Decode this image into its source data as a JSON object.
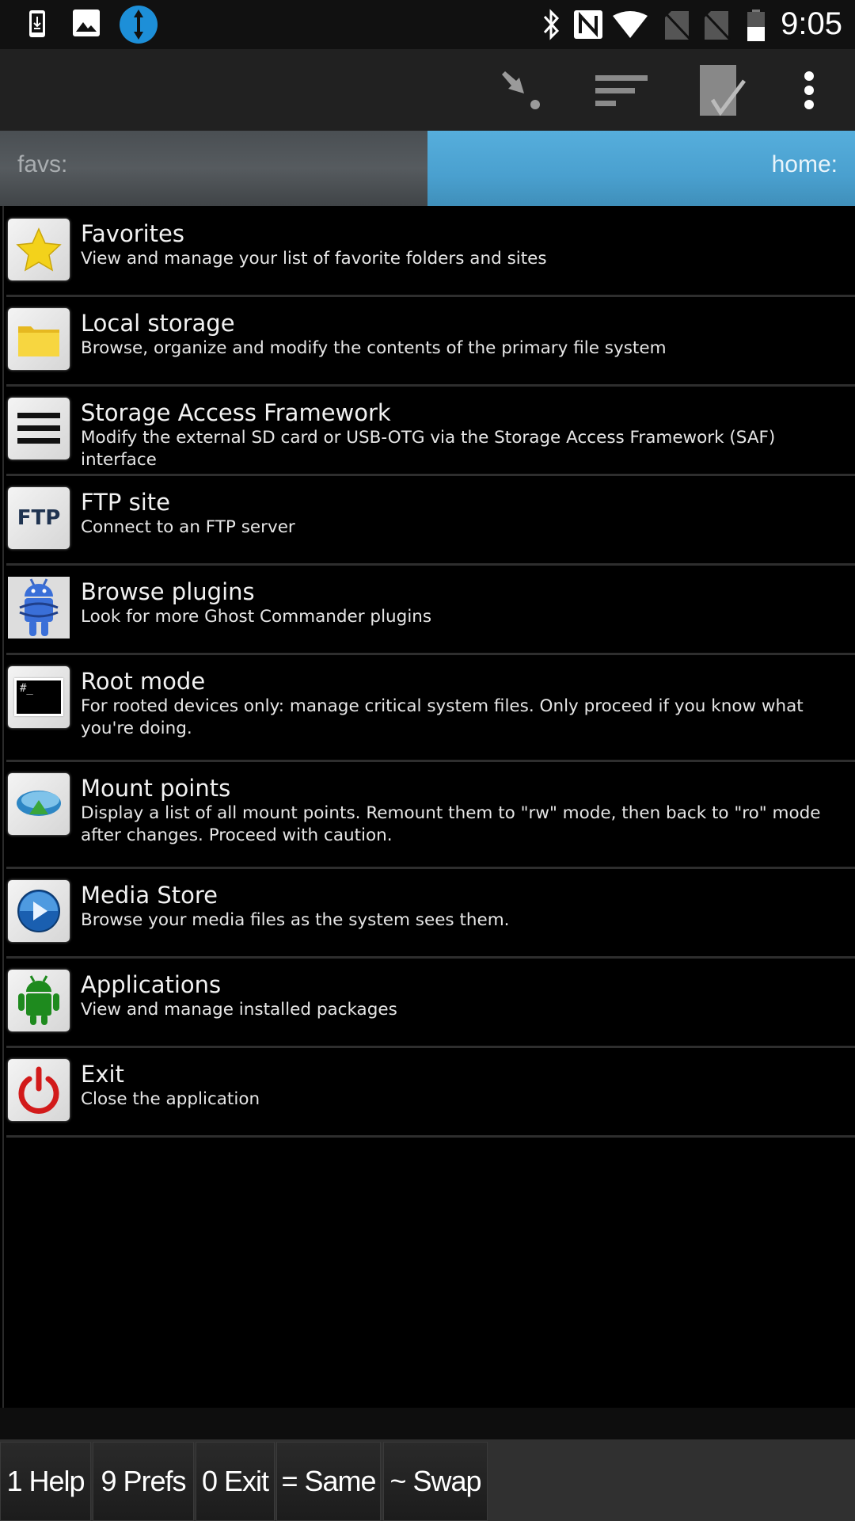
{
  "status_bar": {
    "time": "9:05",
    "left_icons": [
      "download-notification-icon",
      "image-notification-icon",
      "teamviewer-icon"
    ],
    "right_icons": [
      "bluetooth-icon",
      "nfc-icon",
      "wifi-icon",
      "no-sim-icon",
      "no-sim-icon",
      "battery-icon"
    ]
  },
  "toolbar": {
    "actions": [
      "go-to-icon",
      "sort-icon",
      "select-icon",
      "overflow-menu-icon"
    ]
  },
  "tabs": {
    "left": "favs:",
    "right": "home:",
    "active": "right",
    "active_color": "#4ba6d6"
  },
  "list": [
    {
      "title": "Favorites",
      "desc": "View and manage your list of favorite folders and sites",
      "icon": "star-icon"
    },
    {
      "title": "Local storage",
      "desc": "Browse, organize and modify the contents of the primary file system",
      "icon": "folder-icon"
    },
    {
      "title": "Storage Access Framework",
      "desc": "Modify the external SD card or USB-OTG via the Storage Access Framework (SAF) interface",
      "icon": "menu-lines-icon"
    },
    {
      "title": "FTP site",
      "desc": "Connect to an FTP server",
      "icon": "ftp-icon",
      "icon_text": "FTP"
    },
    {
      "title": "Browse plugins",
      "desc": "Look for more Ghost Commander plugins",
      "icon": "android-plugin-icon"
    },
    {
      "title": "Root mode",
      "desc": "For rooted devices only: manage critical system files. Only proceed if you know what you're doing.",
      "icon": "terminal-icon",
      "icon_text": "#_"
    },
    {
      "title": "Mount points",
      "desc": "Display a list of all mount points. Remount them to \"rw\" mode, then back to \"ro\" mode after changes. Proceed with caution.",
      "icon": "mount-icon"
    },
    {
      "title": "Media Store",
      "desc": "Browse your media files as the system sees them.",
      "icon": "play-icon"
    },
    {
      "title": "Applications",
      "desc": "View and manage installed packages",
      "icon": "android-icon"
    },
    {
      "title": "Exit",
      "desc": "Close the application",
      "icon": "power-icon"
    }
  ],
  "bottom_bar": {
    "buttons": [
      "1 Help",
      "9 Prefs",
      "0 Exit",
      "= Same",
      "~ Swap"
    ]
  }
}
